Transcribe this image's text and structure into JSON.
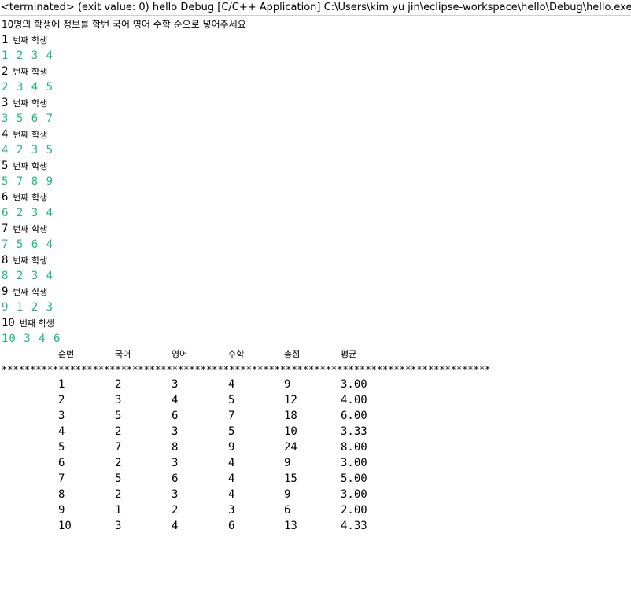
{
  "window": {
    "title": "<terminated> (exit value: 0) hello Debug [C/C++ Application] C:\\Users\\kim yu jin\\eclipse-workspace\\hello\\Debug\\hello.exe"
  },
  "console": {
    "prompt": "10명의 학생에 정보를 학번 국어 영어 수학 순으로 넣어주세요",
    "student_label_suffix": "번째 학생",
    "entries": [
      {
        "num": "1",
        "input": "1 2 3 4"
      },
      {
        "num": "2",
        "input": "2 3 4 5"
      },
      {
        "num": "3",
        "input": "3 5 6 7"
      },
      {
        "num": "4",
        "input": "4 2 3 5"
      },
      {
        "num": "5",
        "input": "5 7 8 9"
      },
      {
        "num": "6",
        "input": "6 2 3 4"
      },
      {
        "num": "7",
        "input": "7 5 6 4"
      },
      {
        "num": "8",
        "input": "8 2 3 4"
      },
      {
        "num": "9",
        "input": "9 1 2 3"
      },
      {
        "num": "10",
        "input": "10 3 4 6"
      }
    ],
    "table": {
      "headers": [
        "순번",
        "국어",
        "영어",
        "수학",
        "총점",
        "평균"
      ],
      "separator": "**************************************************************************************",
      "rows": [
        [
          "1",
          "2",
          "3",
          "4",
          "9",
          "3.00"
        ],
        [
          "2",
          "3",
          "4",
          "5",
          "12",
          "4.00"
        ],
        [
          "3",
          "5",
          "6",
          "7",
          "18",
          "6.00"
        ],
        [
          "4",
          "2",
          "3",
          "5",
          "10",
          "3.33"
        ],
        [
          "5",
          "7",
          "8",
          "9",
          "24",
          "8.00"
        ],
        [
          "6",
          "2",
          "3",
          "4",
          "9",
          "3.00"
        ],
        [
          "7",
          "5",
          "6",
          "4",
          "15",
          "5.00"
        ],
        [
          "8",
          "2",
          "3",
          "4",
          "9",
          "3.00"
        ],
        [
          "9",
          "1",
          "2",
          "3",
          "6",
          "2.00"
        ],
        [
          "10",
          "3",
          "4",
          "6",
          "13",
          "4.33"
        ]
      ]
    }
  },
  "colors": {
    "input_text": "#1dba7d",
    "output_text": "#000000",
    "background": "#ffffff"
  }
}
